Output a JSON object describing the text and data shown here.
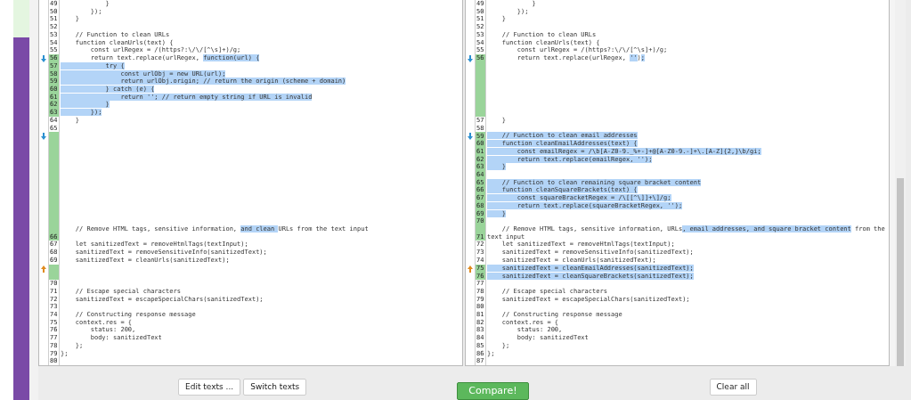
{
  "rows": [
    {
      "left": {
        "number": "49",
        "changed": false,
        "segments": [
          {
            "text": "            }",
            "highlighted": false
          }
        ]
      },
      "right": {
        "number": "49",
        "changed": false,
        "segments": [
          {
            "text": "            }",
            "highlighted": false
          }
        ]
      }
    },
    {
      "left": {
        "number": "50",
        "changed": false,
        "segments": [
          {
            "text": "        });",
            "highlighted": false
          }
        ]
      },
      "right": {
        "number": "50",
        "changed": false,
        "segments": [
          {
            "text": "        });",
            "highlighted": false
          }
        ]
      }
    },
    {
      "left": {
        "number": "51",
        "changed": false,
        "segments": [
          {
            "text": "    }",
            "highlighted": false
          }
        ]
      },
      "right": {
        "number": "51",
        "changed": false,
        "segments": [
          {
            "text": "    }",
            "highlighted": false
          }
        ]
      }
    },
    {
      "left": {
        "number": "52",
        "changed": false
      },
      "right": {
        "number": "52",
        "changed": false
      }
    },
    {
      "left": {
        "number": "53",
        "changed": false,
        "segments": [
          {
            "text": "    // Function to clean URLs",
            "highlighted": false
          }
        ]
      },
      "right": {
        "number": "53",
        "changed": false,
        "segments": [
          {
            "text": "    // Function to clean URLs",
            "highlighted": false
          }
        ]
      }
    },
    {
      "left": {
        "number": "54",
        "changed": false,
        "segments": [
          {
            "text": "    function cleanUrls(text) {",
            "highlighted": false
          }
        ]
      },
      "right": {
        "number": "54",
        "changed": false,
        "segments": [
          {
            "text": "    function cleanUrls(text) {",
            "highlighted": false
          }
        ]
      }
    },
    {
      "left": {
        "number": "55",
        "changed": false,
        "segments": [
          {
            "text": "        const urlRegex = /(https?:\\/\\/[^\\s]+)/g;",
            "highlighted": false
          }
        ]
      },
      "right": {
        "number": "55",
        "changed": false,
        "segments": [
          {
            "text": "        const urlRegex = /(https?:\\/\\/[^\\s]+)/g;",
            "highlighted": false
          }
        ]
      }
    },
    {
      "left": {
        "number": "56",
        "changed": true,
        "marker": {
          "kind": "down"
        },
        "segments": [
          {
            "text": "        return text.replace(urlRegex, ",
            "highlighted": false
          },
          {
            "text": "function(url) {",
            "highlighted": true
          }
        ]
      },
      "right": {
        "number": "56",
        "changed": true,
        "marker": {
          "kind": "down"
        },
        "segments": [
          {
            "text": "        return text.replace(urlRegex, ",
            "highlighted": false
          },
          {
            "text": "''",
            "highlighted": true
          },
          {
            "text": ")",
            "highlighted": false
          },
          {
            "text": ";",
            "highlighted": true
          }
        ]
      }
    },
    {
      "left": {
        "number": "57",
        "changed": true,
        "segments": [
          {
            "text": "            try {",
            "highlighted": true
          }
        ]
      },
      "right": {
        "changed": true
      }
    },
    {
      "left": {
        "number": "58",
        "changed": true,
        "segments": [
          {
            "text": "                const urlObj = new URL(url);",
            "highlighted": true
          }
        ]
      },
      "right": {
        "changed": true
      }
    },
    {
      "left": {
        "number": "59",
        "changed": true,
        "segments": [
          {
            "text": "                return urlObj.origin; // return the origin (scheme + domain)",
            "highlighted": true
          }
        ]
      },
      "right": {
        "changed": true
      }
    },
    {
      "left": {
        "number": "60",
        "changed": true,
        "segments": [
          {
            "text": "            } catch (e) {",
            "highlighted": true
          }
        ]
      },
      "right": {
        "changed": true
      }
    },
    {
      "left": {
        "number": "61",
        "changed": true,
        "segments": [
          {
            "text": "                return ''; // return empty string if URL is invalid",
            "highlighted": true
          }
        ]
      },
      "right": {
        "changed": true
      }
    },
    {
      "left": {
        "number": "62",
        "changed": true,
        "segments": [
          {
            "text": "            }",
            "highlighted": true
          }
        ]
      },
      "right": {
        "changed": true
      }
    },
    {
      "left": {
        "number": "63",
        "changed": true,
        "segments": [
          {
            "text": "        });",
            "highlighted": true
          }
        ]
      },
      "right": {
        "changed": true
      }
    },
    {
      "left": {
        "number": "64",
        "changed": false,
        "segments": [
          {
            "text": "    }",
            "highlighted": false
          }
        ]
      },
      "right": {
        "number": "57",
        "changed": false,
        "segments": [
          {
            "text": "    }",
            "highlighted": false
          }
        ]
      }
    },
    {
      "left": {
        "number": "65",
        "changed": false
      },
      "right": {
        "number": "58",
        "changed": false
      }
    },
    {
      "left": {
        "changed": true,
        "marker": {
          "kind": "down"
        }
      },
      "right": {
        "number": "59",
        "changed": true,
        "marker": {
          "kind": "down"
        },
        "segments": [
          {
            "text": "    // Function to clean email addresses",
            "highlighted": true
          }
        ]
      }
    },
    {
      "left": {
        "changed": true
      },
      "right": {
        "number": "60",
        "changed": true,
        "segments": [
          {
            "text": "    function cleanEmailAddresses(text) {",
            "highlighted": true
          }
        ]
      }
    },
    {
      "left": {
        "changed": true
      },
      "right": {
        "number": "61",
        "changed": true,
        "segments": [
          {
            "text": "        const emailRegex = /\\b[A-Z0-9._%+-]+@[A-Z0-9.-]+\\.[A-Z]{2,}\\b/gi;",
            "highlighted": true
          }
        ]
      }
    },
    {
      "left": {
        "changed": true
      },
      "right": {
        "number": "62",
        "changed": true,
        "segments": [
          {
            "text": "        return text.replace(emailRegex, '');",
            "highlighted": true
          }
        ]
      }
    },
    {
      "left": {
        "changed": true
      },
      "right": {
        "number": "63",
        "changed": true,
        "segments": [
          {
            "text": "    }",
            "highlighted": true
          }
        ]
      }
    },
    {
      "left": {
        "changed": true
      },
      "right": {
        "number": "64",
        "changed": true
      }
    },
    {
      "left": {
        "changed": true
      },
      "right": {
        "number": "65",
        "changed": true,
        "segments": [
          {
            "text": "    // Function to clean remaining square bracket content",
            "highlighted": true
          }
        ]
      }
    },
    {
      "left": {
        "changed": true
      },
      "right": {
        "number": "66",
        "changed": true,
        "segments": [
          {
            "text": "    function cleanSquareBrackets(text) {",
            "highlighted": true
          }
        ]
      }
    },
    {
      "left": {
        "changed": true
      },
      "right": {
        "number": "67",
        "changed": true,
        "segments": [
          {
            "text": "        const squareBracketRegex = /\\[[^\\]]+\\]/g;",
            "highlighted": true
          }
        ]
      }
    },
    {
      "left": {
        "changed": true
      },
      "right": {
        "number": "68",
        "changed": true,
        "segments": [
          {
            "text": "        return text.replace(squareBracketRegex, '');",
            "highlighted": true
          }
        ]
      }
    },
    {
      "left": {
        "changed": true
      },
      "right": {
        "number": "69",
        "changed": true,
        "segments": [
          {
            "text": "    }",
            "highlighted": true
          }
        ]
      }
    },
    {
      "left": {
        "changed": true
      },
      "right": {
        "number": "70",
        "changed": true
      }
    },
    {
      "left": {
        "number": "66",
        "changed": true,
        "segments": [
          {
            "text": "    // Remove HTML tags, sensitive information, ",
            "highlighted": false
          },
          {
            "text": "and clean ",
            "highlighted": true
          },
          {
            "text": "URLs from the text input",
            "highlighted": false
          }
        ]
      },
      "right": {
        "number": "71",
        "changed": true,
        "segments": [
          {
            "text": "    // Remove HTML tags, sensitive information, URLs",
            "highlighted": false
          },
          {
            "text": ", email addresses, and square bracket content",
            "highlighted": true
          },
          {
            "text": " from the text input",
            "highlighted": false
          }
        ]
      }
    },
    {
      "left": {
        "number": "67",
        "changed": false,
        "segments": [
          {
            "text": "    let sanitizedText = removeHtmlTags(textInput);",
            "highlighted": false
          }
        ]
      },
      "right": {
        "number": "72",
        "changed": false,
        "segments": [
          {
            "text": "    let sanitizedText = removeHtmlTags(textInput);",
            "highlighted": false
          }
        ]
      }
    },
    {
      "left": {
        "number": "68",
        "changed": false,
        "segments": [
          {
            "text": "    sanitizedText = removeSensitiveInfo(sanitizedText);",
            "highlighted": false
          }
        ]
      },
      "right": {
        "number": "73",
        "changed": false,
        "segments": [
          {
            "text": "    sanitizedText = removeSensitiveInfo(sanitizedText);",
            "highlighted": false
          }
        ]
      }
    },
    {
      "left": {
        "number": "69",
        "changed": false,
        "segments": [
          {
            "text": "    sanitizedText = cleanUrls(sanitizedText);",
            "highlighted": false
          }
        ]
      },
      "right": {
        "number": "74",
        "changed": false,
        "segments": [
          {
            "text": "    sanitizedText = cleanUrls(sanitizedText);",
            "highlighted": false
          }
        ]
      }
    },
    {
      "left": {
        "changed": true,
        "marker": {
          "kind": "up"
        }
      },
      "right": {
        "number": "75",
        "changed": true,
        "marker": {
          "kind": "up"
        },
        "segments": [
          {
            "text": "    sanitizedText = cleanEmailAddresses(sanitizedText);",
            "highlighted": true
          }
        ]
      }
    },
    {
      "left": {
        "changed": true
      },
      "right": {
        "number": "76",
        "changed": true,
        "segments": [
          {
            "text": "    sanitizedText = cleanSquareBrackets(sanitizedText);",
            "highlighted": true
          }
        ]
      }
    },
    {
      "left": {
        "number": "70",
        "changed": false
      },
      "right": {
        "number": "77",
        "changed": false
      }
    },
    {
      "left": {
        "number": "71",
        "changed": false,
        "segments": [
          {
            "text": "    // Escape special characters",
            "highlighted": false
          }
        ]
      },
      "right": {
        "number": "78",
        "changed": false,
        "segments": [
          {
            "text": "    // Escape special characters",
            "highlighted": false
          }
        ]
      }
    },
    {
      "left": {
        "number": "72",
        "changed": false,
        "segments": [
          {
            "text": "    sanitizedText = escapeSpecialChars(sanitizedText);",
            "highlighted": false
          }
        ]
      },
      "right": {
        "number": "79",
        "changed": false,
        "segments": [
          {
            "text": "    sanitizedText = escapeSpecialChars(sanitizedText);",
            "highlighted": false
          }
        ]
      }
    },
    {
      "left": {
        "number": "73",
        "changed": false
      },
      "right": {
        "number": "80",
        "changed": false
      }
    },
    {
      "left": {
        "number": "74",
        "changed": false,
        "segments": [
          {
            "text": "    // Constructing response message",
            "highlighted": false
          }
        ]
      },
      "right": {
        "number": "81",
        "changed": false,
        "segments": [
          {
            "text": "    // Constructing response message",
            "highlighted": false
          }
        ]
      }
    },
    {
      "left": {
        "number": "75",
        "changed": false,
        "segments": [
          {
            "text": "    context.res = {",
            "highlighted": false
          }
        ]
      },
      "right": {
        "number": "82",
        "changed": false,
        "segments": [
          {
            "text": "    context.res = {",
            "highlighted": false
          }
        ]
      }
    },
    {
      "left": {
        "number": "76",
        "changed": false,
        "segments": [
          {
            "text": "        status: 200,",
            "highlighted": false
          }
        ]
      },
      "right": {
        "number": "83",
        "changed": false,
        "segments": [
          {
            "text": "        status: 200,",
            "highlighted": false
          }
        ]
      }
    },
    {
      "left": {
        "number": "77",
        "changed": false,
        "segments": [
          {
            "text": "        body: sanitizedText",
            "highlighted": false
          }
        ]
      },
      "right": {
        "number": "84",
        "changed": false,
        "segments": [
          {
            "text": "        body: sanitizedText",
            "highlighted": false
          }
        ]
      }
    },
    {
      "left": {
        "number": "78",
        "changed": false,
        "segments": [
          {
            "text": "    };",
            "highlighted": false
          }
        ]
      },
      "right": {
        "number": "85",
        "changed": false,
        "segments": [
          {
            "text": "    };",
            "highlighted": false
          }
        ]
      }
    },
    {
      "left": {
        "number": "79",
        "changed": false,
        "segments": [
          {
            "text": "};",
            "highlighted": false
          }
        ]
      },
      "right": {
        "number": "86",
        "changed": false,
        "segments": [
          {
            "text": "};",
            "highlighted": false
          }
        ]
      }
    },
    {
      "left": {
        "number": "80",
        "changed": false
      },
      "right": {
        "number": "87",
        "changed": false
      }
    }
  ],
  "buttons": [
    {
      "label": "Edit texts ...",
      "kind": "default"
    },
    {
      "label": "Switch texts",
      "kind": "default"
    },
    {
      "label": "Compare!",
      "kind": "primary"
    },
    {
      "label": "Clear all",
      "kind": "default"
    }
  ]
}
